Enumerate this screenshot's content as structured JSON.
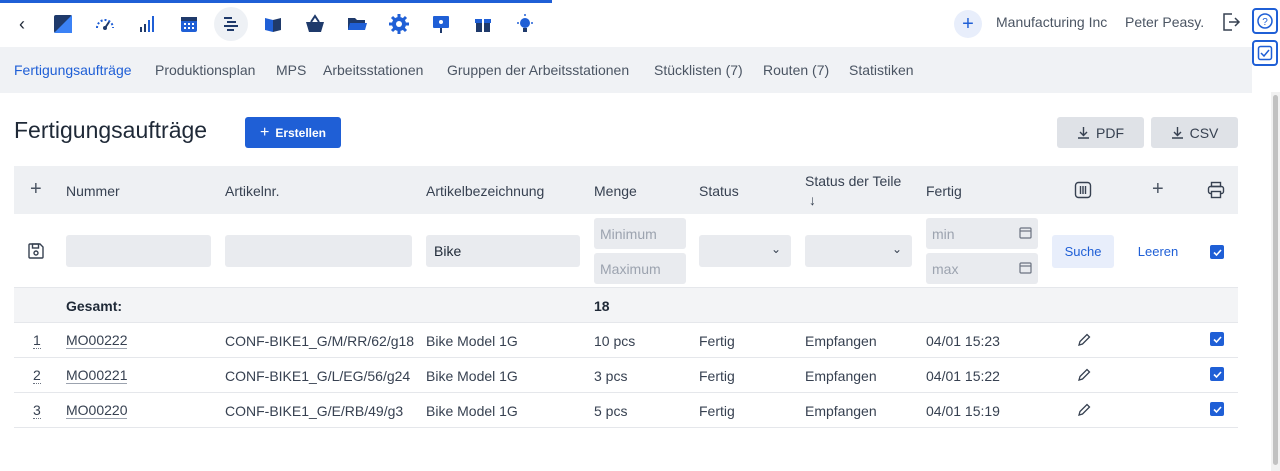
{
  "topbar": {
    "app_icons": [
      "dashboard-icon",
      "gauge-icon",
      "signal-bars-icon",
      "calendar-icon",
      "production-list-icon",
      "book-icon",
      "basket-icon",
      "folder-icon",
      "gear-icon",
      "presentation-icon",
      "gift-icon",
      "lightbulb-icon"
    ],
    "active_icon": "production-list-icon",
    "company": "Manufacturing Inc",
    "user": "Peter Peasy."
  },
  "nav": {
    "tabs": [
      "Fertigungsaufträge",
      "Produktionsplan",
      "MPS",
      "Arbeitsstationen",
      "Gruppen der Arbeitsstationen",
      "Stücklisten (7)",
      "Routen (7)",
      "Statistiken"
    ],
    "active": "Fertigungsaufträge"
  },
  "page": {
    "title": "Fertigungsaufträge",
    "create_label": "Erstellen",
    "pdf_label": "PDF",
    "csv_label": "CSV"
  },
  "table": {
    "headers": {
      "number": "Nummer",
      "article_no": "Artikelnr.",
      "article_name": "Artikelbezeichnung",
      "quantity": "Menge",
      "status": "Status",
      "parts_status": "Status der Teile",
      "parts_status_sort": "↓",
      "done": "Fertig"
    },
    "filters": {
      "number": "",
      "article_no": "",
      "article_name": "Bike",
      "qty_min_placeholder": "Minimum",
      "qty_max_placeholder": "Maximum",
      "date_min_placeholder": "min",
      "date_max_placeholder": "max",
      "search_label": "Suche",
      "clear_label": "Leeren"
    },
    "total_label": "Gesamt:",
    "total_quantity": "18",
    "rows": [
      {
        "index": "1",
        "number": "MO00222",
        "article_no": "CONF-BIKE1_G/M/RR/62/g18",
        "article_name": "Bike Model 1G",
        "quantity": "10 pcs",
        "status": "Fertig",
        "parts_status": "Empfangen",
        "done": "04/01 15:23",
        "checked": true
      },
      {
        "index": "2",
        "number": "MO00221",
        "article_no": "CONF-BIKE1_G/L/EG/56/g24",
        "article_name": "Bike Model 1G",
        "quantity": "3 pcs",
        "status": "Fertig",
        "parts_status": "Empfangen",
        "done": "04/01 15:22",
        "checked": true
      },
      {
        "index": "3",
        "number": "MO00220",
        "article_no": "CONF-BIKE1_G/E/RB/49/g3",
        "article_name": "Bike Model 1G",
        "quantity": "5 pcs",
        "status": "Fertig",
        "parts_status": "Empfangen",
        "done": "04/01 15:19",
        "checked": true
      }
    ]
  },
  "colors": {
    "accent": "#1f5fd6",
    "header_bg": "#eef0f3",
    "nav_bg": "#f0f2f5"
  }
}
